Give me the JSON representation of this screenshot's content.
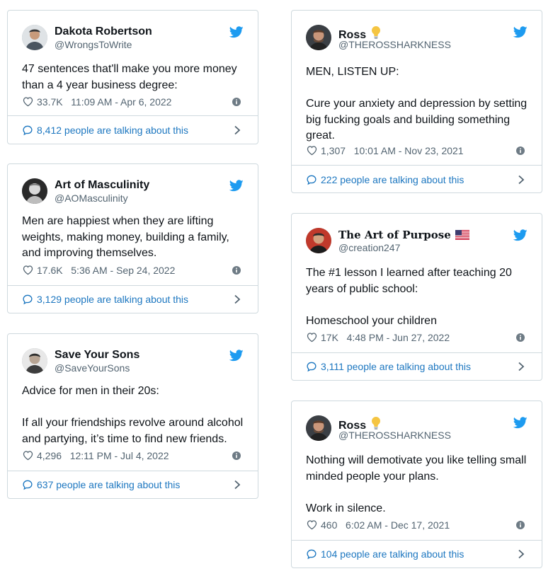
{
  "colors": {
    "brand": "#1d9bf0",
    "link": "#1d77c0",
    "muted": "#536471",
    "border": "#cfd9de"
  },
  "icons": {
    "bird": "twitter-bird-icon",
    "like": "heart-icon",
    "info": "info-icon",
    "talk": "speech-bubble-icon",
    "more": "chevron-right-icon",
    "bulb": "light-bulb-emoji",
    "flag": "us-flag-emoji"
  },
  "tweets": [
    {
      "name": "Dakota Robertson",
      "handle": "@WrongsToWrite",
      "text": "47 sentences that'll make you more money than a 4 year business degree:",
      "likes": "33.7K",
      "time": "11:09 AM - Apr 6, 2022",
      "talk": "8,412 people are talking about this"
    },
    {
      "name": "Art of Masculinity",
      "handle": "@AOMasculinity",
      "text": "Men are happiest when they are lifting weights, making money, building a family, and improving themselves.",
      "likes": "17.6K",
      "time": "5:36 AM - Sep 24, 2022",
      "talk": "3,129 people are talking about this"
    },
    {
      "name": "Save Your Sons",
      "handle": "@SaveYourSons",
      "text": "Advice for men in their 20s:\n\nIf all your friendships revolve around alcohol and partying, it’s time to find new friends.",
      "likes": "4,296",
      "time": "12:11 PM - Jul 4, 2022",
      "talk": "637 people are talking about this"
    },
    {
      "name": "Ross",
      "handle": "@THEROSSHARKNESS",
      "text": "MEN, LISTEN UP:\n\nCure your anxiety and depression by setting big fucking goals and building something great.",
      "likes": "1,307",
      "time": "10:01 AM - Nov 23, 2021",
      "talk": "222 people are talking about this"
    },
    {
      "name": "The Art of Purpose",
      "handle": "@creation247",
      "text": "The #1 lesson I learned after teaching 20 years of public school:\n\nHomeschool your children",
      "likes": "17K",
      "time": "4:48 PM - Jun 27, 2022",
      "talk": "3,111 people are talking about this"
    },
    {
      "name": "Ross",
      "handle": "@THEROSSHARKNESS",
      "text": "Nothing will demotivate you like telling small minded people your plans.\n\nWork in silence.",
      "likes": "460",
      "time": "6:02 AM - Dec 17, 2021",
      "talk": "104 people are talking about this"
    }
  ]
}
